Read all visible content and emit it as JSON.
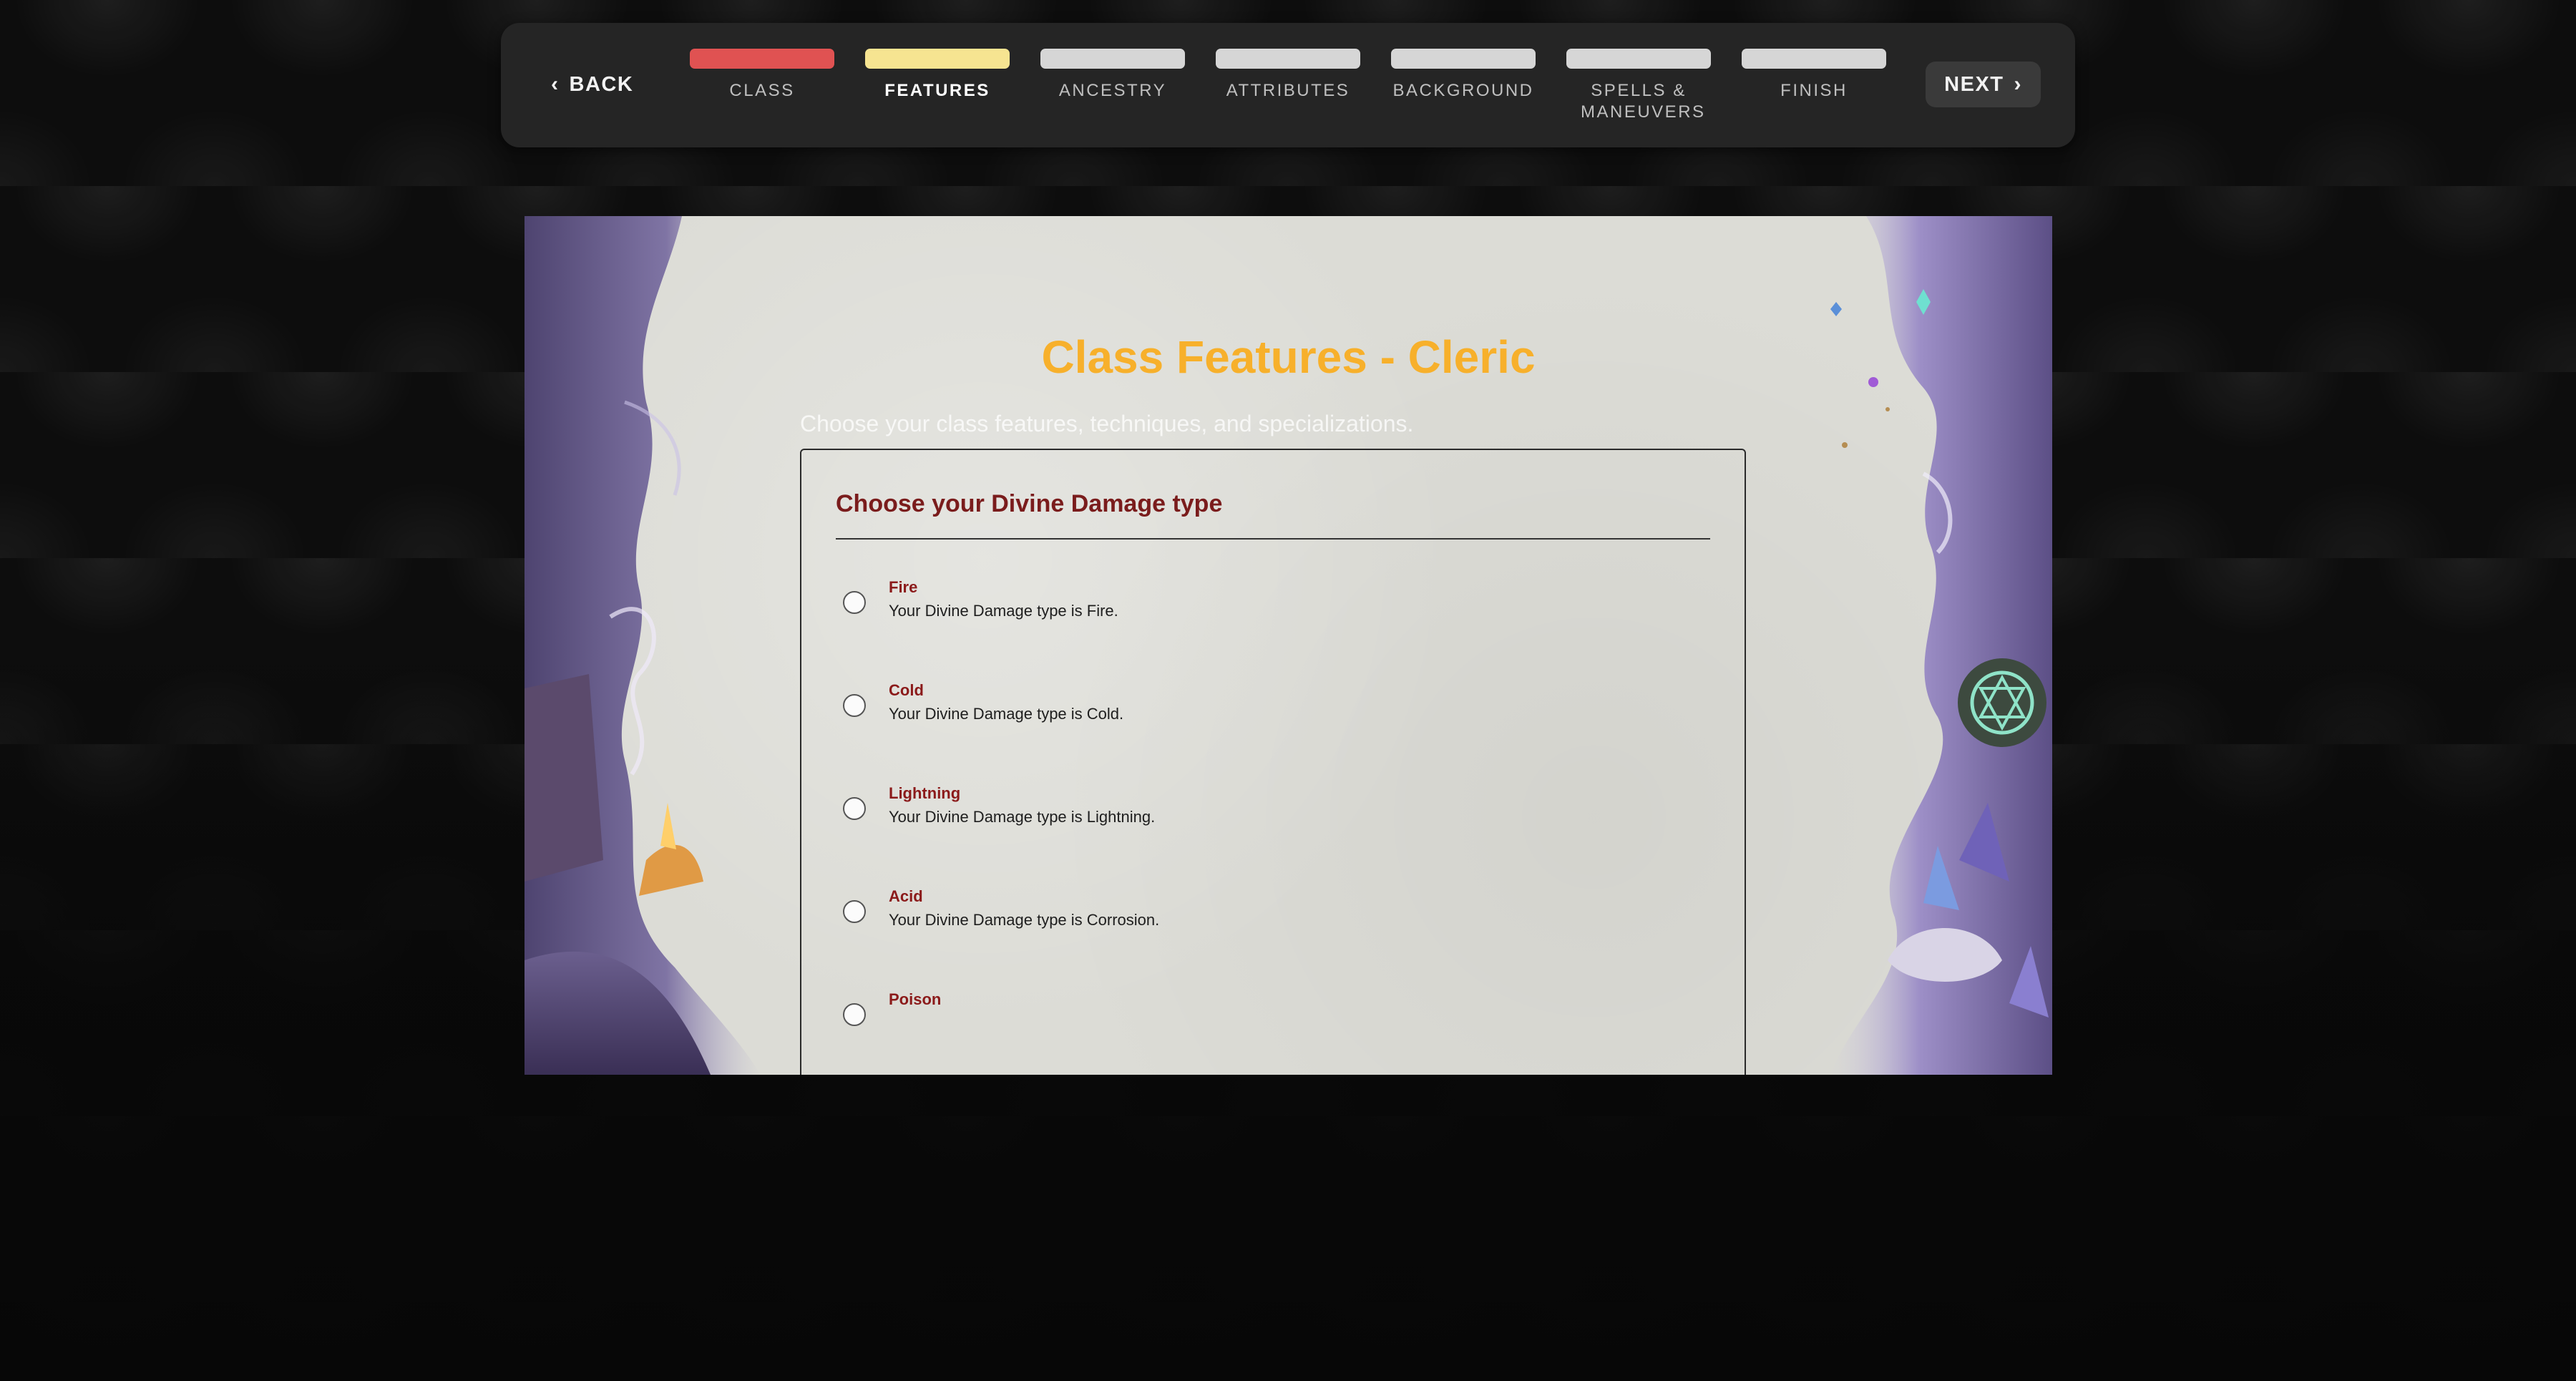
{
  "nav": {
    "back_label": "BACK",
    "next_label": "NEXT",
    "steps": [
      {
        "label": "CLASS",
        "color": "#e05252"
      },
      {
        "label": "FEATURES",
        "color": "#f6e491"
      },
      {
        "label": "ANCESTRY",
        "color": "#d6d6d6"
      },
      {
        "label": "ATTRIBUTES",
        "color": "#d6d6d6"
      },
      {
        "label": "BACKGROUND",
        "color": "#d6d6d6"
      },
      {
        "label": "SPELLS & MANEUVERS",
        "color": "#d6d6d6"
      },
      {
        "label": "FINISH",
        "color": "#d6d6d6"
      }
    ]
  },
  "page": {
    "title": "Class Features - Cleric",
    "subtitle": "Choose your class features, techniques, and specializations.",
    "title_color": "#f7b02b"
  },
  "section": {
    "heading": "Choose your Divine Damage type",
    "options": [
      {
        "name": "Fire",
        "desc": "Your Divine Damage type is Fire."
      },
      {
        "name": "Cold",
        "desc": "Your Divine Damage type is Cold."
      },
      {
        "name": "Lightning",
        "desc": "Your Divine Damage type is Lightning."
      },
      {
        "name": "Acid",
        "desc": "Your Divine Damage type is Corrosion."
      },
      {
        "name": "Poison",
        "desc": ""
      }
    ]
  }
}
